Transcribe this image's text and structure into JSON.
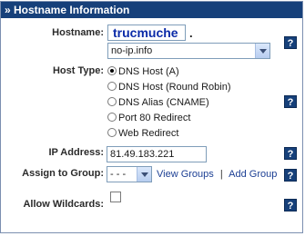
{
  "panel": {
    "title": "» Hostname Information"
  },
  "hostname": {
    "label": "Hostname:",
    "value": "trucmuche",
    "dot": ".",
    "domain_selected": "no-ip.info"
  },
  "host_type": {
    "label": "Host Type:",
    "options": [
      {
        "label": "DNS Host (A)",
        "checked": true
      },
      {
        "label": "DNS Host (Round Robin)",
        "checked": false
      },
      {
        "label": "DNS Alias (CNAME)",
        "checked": false
      },
      {
        "label": "Port 80 Redirect",
        "checked": false
      },
      {
        "label": "Web Redirect",
        "checked": false
      }
    ]
  },
  "ip_address": {
    "label": "IP Address:",
    "value": "81.49.183.221"
  },
  "assign_group": {
    "label": "Assign to Group:",
    "selected": "- - -",
    "view_groups": "View Groups",
    "separator": "|",
    "add_group": "Add Group"
  },
  "wildcards": {
    "label": "Allow Wildcards:",
    "checked": false
  },
  "help": {
    "glyph": "?"
  },
  "colors": {
    "header_bg": "#16407a",
    "help_bg": "#16407a",
    "hostname_text": "#0b2ba8",
    "link": "#1c3f94"
  }
}
